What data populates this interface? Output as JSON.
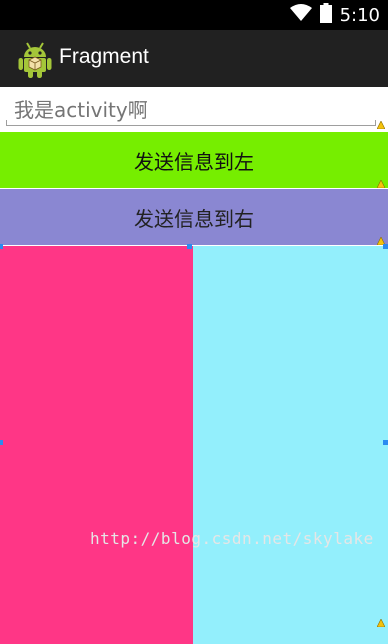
{
  "status_bar": {
    "time": "5:10",
    "icons": [
      "wifi-icon",
      "battery-icon"
    ]
  },
  "action_bar": {
    "title": "Fragment",
    "icon": "android-robot-icon"
  },
  "edit": {
    "value": "我是activity啊"
  },
  "buttons": {
    "send_left": "发送信息到左",
    "send_right": "发送信息到右"
  },
  "fragments": {
    "left_color": "#ff3686",
    "right_color": "#93effc"
  },
  "colors": {
    "send_left_bg": "#76ee00",
    "send_right_bg": "#8a87d2",
    "action_bar_bg": "#212121"
  },
  "watermark": "http://blog.csdn.net/skylake"
}
